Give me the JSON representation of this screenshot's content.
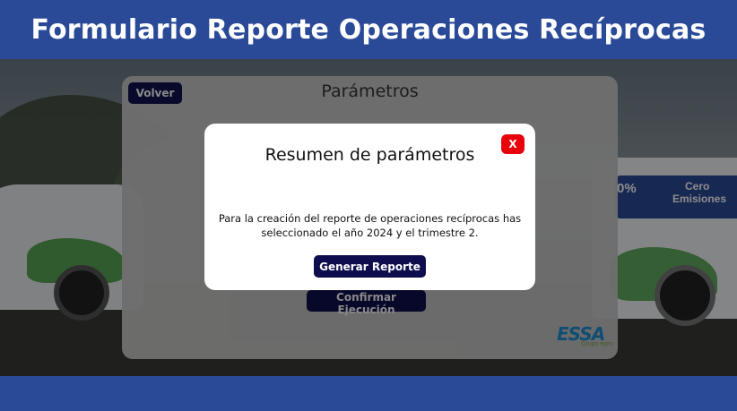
{
  "header": {
    "title": "Formulario Reporte Operaciones Recíprocas"
  },
  "background": {
    "van_right_text_1": "0%",
    "van_right_text_2": "Cero",
    "van_right_text_3": "Emisiones"
  },
  "panel": {
    "title": "Parámetros",
    "back_label": "Volver",
    "confirm_label": "Confirmar Ejecución",
    "logo_text": "ESSA",
    "logo_subtext": "Grupo epm"
  },
  "modal": {
    "title": "Resumen de parámetros",
    "close_label": "X",
    "body_text": "Para la creación del reporte de operaciones recíprocas has seleccionado el año 2024 y el trimestre 2.",
    "generate_label": "Generar Reporte"
  },
  "colors": {
    "header_bg": "#2a4a98",
    "button_navy": "#0e0e4f",
    "close_red": "#e8000b",
    "logo_blue": "#1f8fd6",
    "logo_green": "#7aa84a"
  }
}
